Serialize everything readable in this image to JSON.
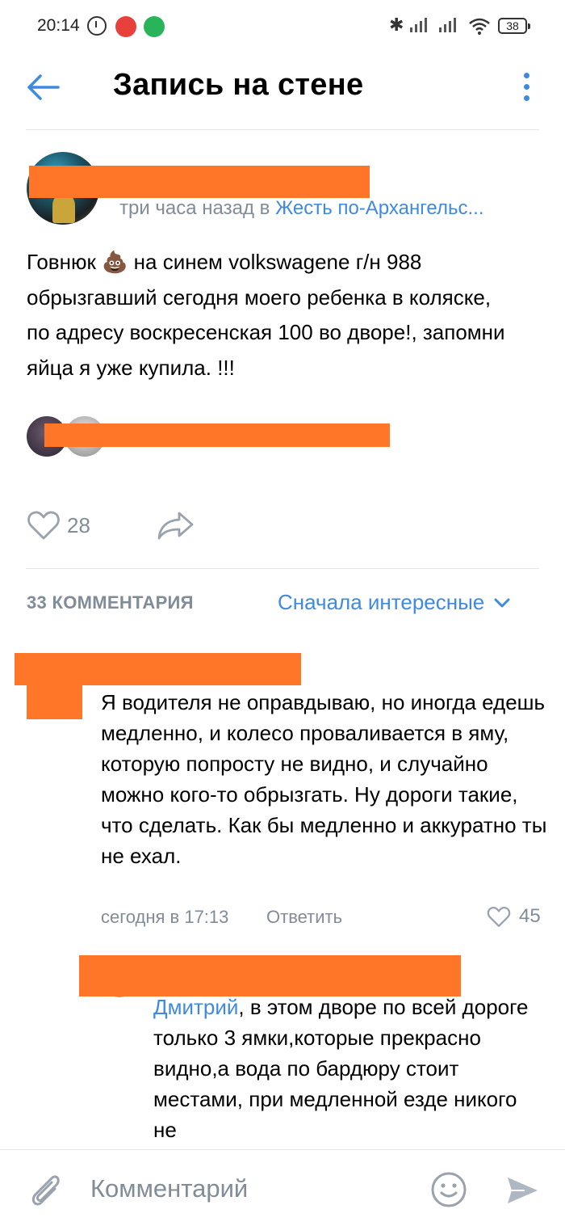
{
  "status_bar": {
    "time": "20:14",
    "battery": "38"
  },
  "header": {
    "title": "Запись на стене"
  },
  "post": {
    "meta_time": "три часа назад в ",
    "group_name": "Жесть по-Архангельс...",
    "text_before_emoji": "Говнюк ",
    "emoji": "💩",
    "text_after_emoji": "  на синем   volkswagene г/н 988   обрызгавший сегодня моего ребенка в коляске, по адресу воскресенская 100 во дворе!, запомни яйца я уже купила. !!!",
    "likes": "28"
  },
  "comments_header": {
    "count_label": "33 КОММЕНТАРИЯ",
    "sort_label": "Сначала интересные"
  },
  "comments": [
    {
      "text": "Я водителя не оправдываю, но иногда едешь медленно, и колесо проваливается в яму, которую попросту не видно, и случайно можно кого-то обрызгать. Ну дороги такие, что сделать. Как бы медленно и аккуратно ты не ехал.",
      "date": "сегодня в 17:13",
      "reply_label": "Ответить",
      "likes": "45"
    },
    {
      "mention": "Дмитрий",
      "text": ", в этом дворе по всей дороге только 3 ямки,которые прекрасно видно,а вода по бардюру  стоит местами, при медленной езде никого не"
    }
  ],
  "composer": {
    "placeholder": "Комментарий"
  },
  "colors": {
    "accent": "#3f8ae0",
    "secondary_text": "#818c99",
    "redaction": "#ff7629"
  }
}
